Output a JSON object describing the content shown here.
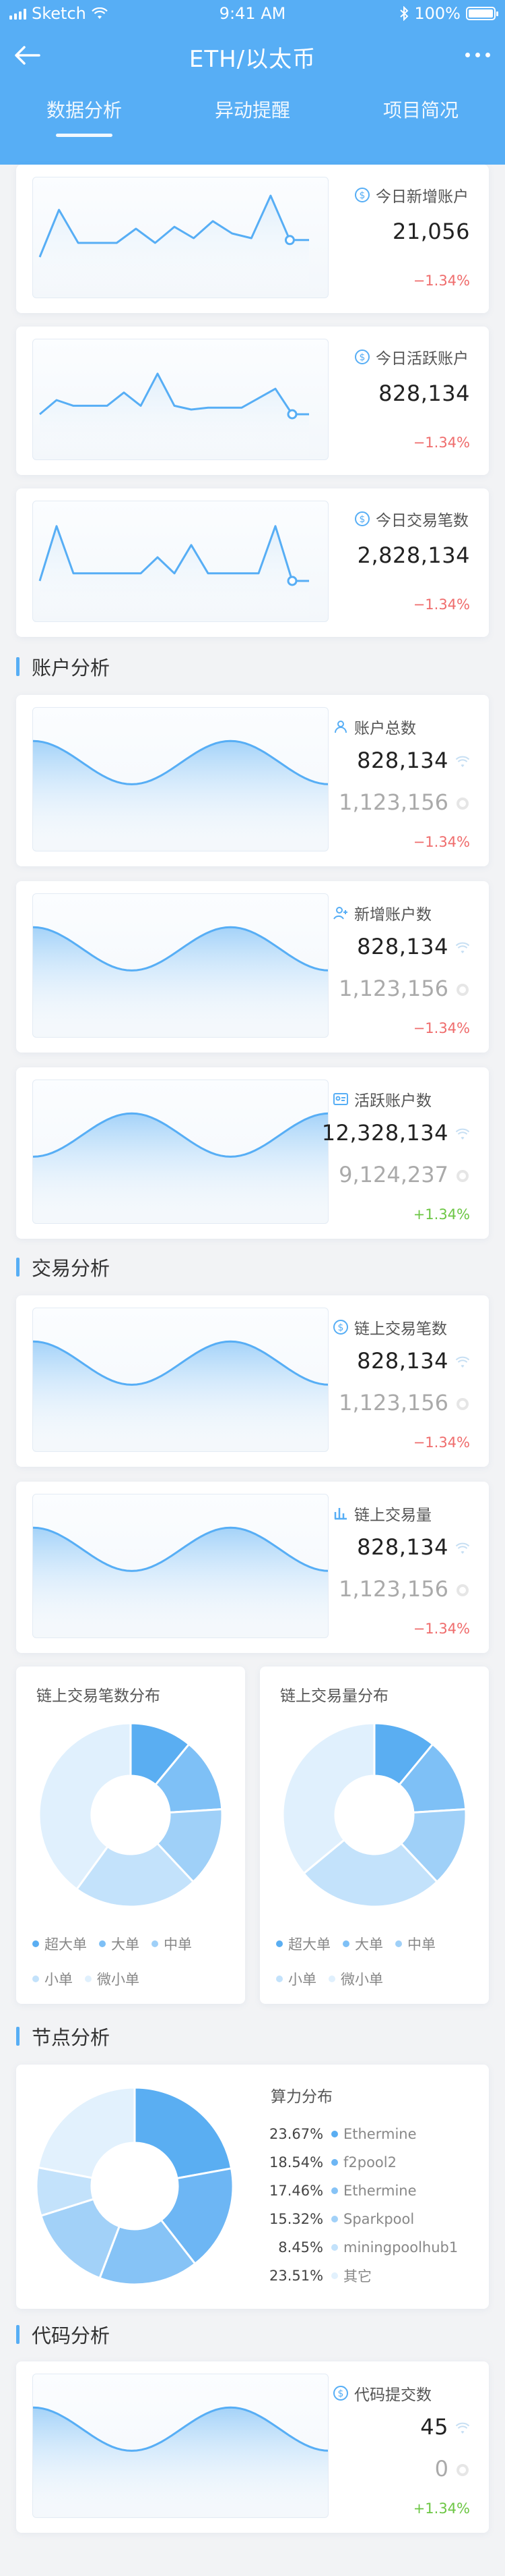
{
  "status": {
    "carrier": "Sketch",
    "time": "9:41 AM",
    "battery": "100%"
  },
  "nav": {
    "title": "ETH/以太币"
  },
  "tabs": [
    {
      "label": "数据分析"
    },
    {
      "label": "异动提醒"
    },
    {
      "label": "项目简况"
    }
  ],
  "colors": {
    "primary": "#57aef5",
    "negative": "#ef6c6c",
    "positive": "#6cc644"
  },
  "top_cards": [
    {
      "label": "今日新增账户",
      "value": "21,056",
      "change": "−1.34%",
      "chart_data": {
        "type": "line",
        "values": [
          30,
          80,
          45,
          45,
          45,
          60,
          45,
          62,
          50,
          68,
          55,
          50,
          95,
          48,
          48
        ]
      }
    },
    {
      "label": "今日活跃账户",
      "value": "828,134",
      "change": "−1.34%",
      "chart_data": {
        "type": "line",
        "values": [
          35,
          50,
          44,
          44,
          44,
          58,
          44,
          78,
          44,
          40,
          42,
          42,
          42,
          52,
          62,
          35,
          35
        ]
      }
    },
    {
      "label": "今日交易笔数",
      "value": "2,828,134",
      "change": "−1.34%",
      "chart_data": {
        "type": "line",
        "values": [
          30,
          88,
          38,
          38,
          38,
          38,
          38,
          55,
          38,
          68,
          38,
          38,
          38,
          38,
          88,
          30,
          30
        ]
      }
    }
  ],
  "sections": {
    "account": "账户分析",
    "trade": "交易分析",
    "node": "节点分析",
    "code": "代码分析"
  },
  "account_cards": [
    {
      "label": "账户总数",
      "icon": "user-icon",
      "value": "828,134",
      "value2": "1,123,156",
      "change": "−1.34%",
      "change_sign": "neg",
      "chart_data": {
        "type": "area",
        "shape": "down-up-down"
      }
    },
    {
      "label": "新增账户数",
      "icon": "user-add-icon",
      "value": "828,134",
      "value2": "1,123,156",
      "change": "−1.34%",
      "change_sign": "neg",
      "chart_data": {
        "type": "area",
        "shape": "down-up-down"
      }
    },
    {
      "label": "活跃账户数",
      "icon": "id-card-icon",
      "value": "12,328,134",
      "value2": "9,124,237",
      "change": "+1.34%",
      "change_sign": "pos",
      "chart_data": {
        "type": "area",
        "shape": "up-down-up"
      }
    }
  ],
  "trade_cards": [
    {
      "label": "链上交易笔数",
      "icon": "coin-icon",
      "value": "828,134",
      "value2": "1,123,156",
      "change": "−1.34%",
      "change_sign": "neg",
      "chart_data": {
        "type": "area",
        "shape": "down-up-down"
      }
    },
    {
      "label": "链上交易量",
      "icon": "bar-chart-icon",
      "value": "828,134",
      "value2": "1,123,156",
      "change": "−1.34%",
      "change_sign": "neg",
      "chart_data": {
        "type": "area",
        "shape": "down-up-down"
      }
    }
  ],
  "pie_cards": [
    {
      "title": "链上交易笔数分布",
      "chart_data": {
        "type": "pie",
        "labels": [
          "超大单",
          "大单",
          "中单",
          "小单",
          "微小单"
        ],
        "values": [
          11,
          13,
          14,
          22,
          40
        ]
      }
    },
    {
      "title": "链上交易量分布",
      "chart_data": {
        "type": "pie",
        "labels": [
          "超大单",
          "大单",
          "中单",
          "小单",
          "微小单"
        ],
        "values": [
          11,
          13,
          14,
          26,
          36
        ]
      }
    }
  ],
  "pie_legend": [
    {
      "label": "超大单",
      "color": "#5aaef2"
    },
    {
      "label": "大单",
      "color": "#7ec0f6"
    },
    {
      "label": "中单",
      "color": "#9fd0f8"
    },
    {
      "label": "小单",
      "color": "#c3e2fb"
    },
    {
      "label": "微小单",
      "color": "#e0f0fd"
    }
  ],
  "hashrate": {
    "title": "算力分布",
    "chart_data": {
      "type": "pie",
      "labels": [
        "Ethermine",
        "f2pool2",
        "Ethermine",
        "Sparkpool",
        "miningpoolhub1",
        "其它"
      ],
      "values": [
        23.67,
        18.54,
        17.46,
        15.32,
        8.45,
        23.51
      ]
    },
    "rows": [
      {
        "pct": "23.67%",
        "name": "Ethermine",
        "color": "#5aaef2"
      },
      {
        "pct": "18.54%",
        "name": "f2pool2",
        "color": "#6db6f4"
      },
      {
        "pct": "17.46%",
        "name": "Ethermine",
        "color": "#86c3f6"
      },
      {
        "pct": "15.32%",
        "name": "Sparkpool",
        "color": "#a2d1f8"
      },
      {
        "pct": "8.45%",
        "name": "miningpoolhub1",
        "color": "#c3e2fb"
      },
      {
        "pct": "23.51%",
        "name": "其它",
        "color": "#e2f1fd"
      }
    ]
  },
  "code_card": {
    "label": "代码提交数",
    "icon": "code-icon",
    "value": "45",
    "value2": "0",
    "change": "+1.34%",
    "change_sign": "pos",
    "chart_data": {
      "type": "area",
      "shape": "down-up-down"
    }
  }
}
